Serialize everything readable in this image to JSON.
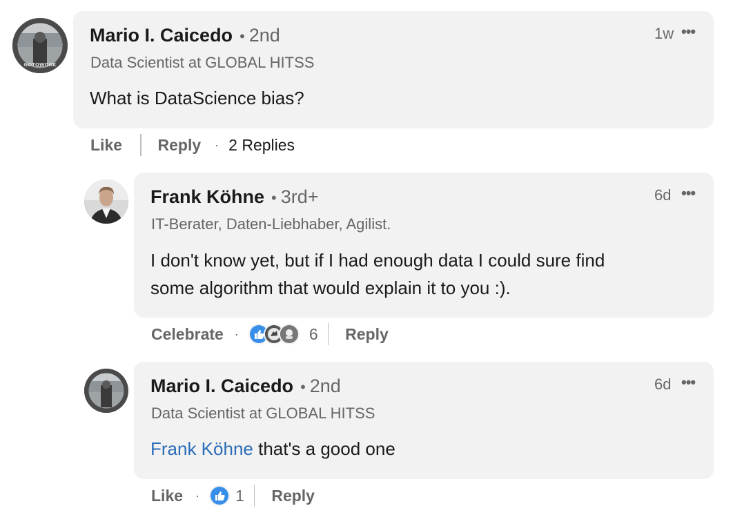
{
  "comment": {
    "author": "Mario I. Caicedo",
    "degree": "2nd",
    "headline": "Data Scientist at GLOBAL HITSS",
    "time": "1w",
    "text": "What is DataScience bias?",
    "actions": {
      "like": "Like",
      "reply": "Reply",
      "replies": "2 Replies"
    },
    "avatar_icon": "profile-photo"
  },
  "replies": [
    {
      "author": "Frank Köhne",
      "degree": "3rd+",
      "headline": "IT-Berater, Daten-Liebhaber, Agilist.",
      "time": "6d",
      "text_line1": "I don't know yet, but if I had enough data I could sure find",
      "text_line2": "some algorithm that would explain it to you :).",
      "actions": {
        "reaction": "Celebrate",
        "reaction_count": "6",
        "reply": "Reply"
      },
      "reaction_icons": [
        "like-icon",
        "celebrate-icon",
        "insightful-icon"
      ]
    },
    {
      "author": "Mario I. Caicedo",
      "degree": "2nd",
      "headline": "Data Scientist at GLOBAL HITSS",
      "time": "6d",
      "mention": "Frank Köhne",
      "text": " that's a good one",
      "actions": {
        "like": "Like",
        "reaction_count": "1",
        "reply": "Reply"
      },
      "reaction_icons": [
        "like-icon"
      ]
    }
  ],
  "colors": {
    "bubble": "#f2f2f2",
    "mention": "#2b6cb8",
    "like": "#378fe9",
    "muted": "#666666"
  },
  "more_icon": "more-options-icon"
}
